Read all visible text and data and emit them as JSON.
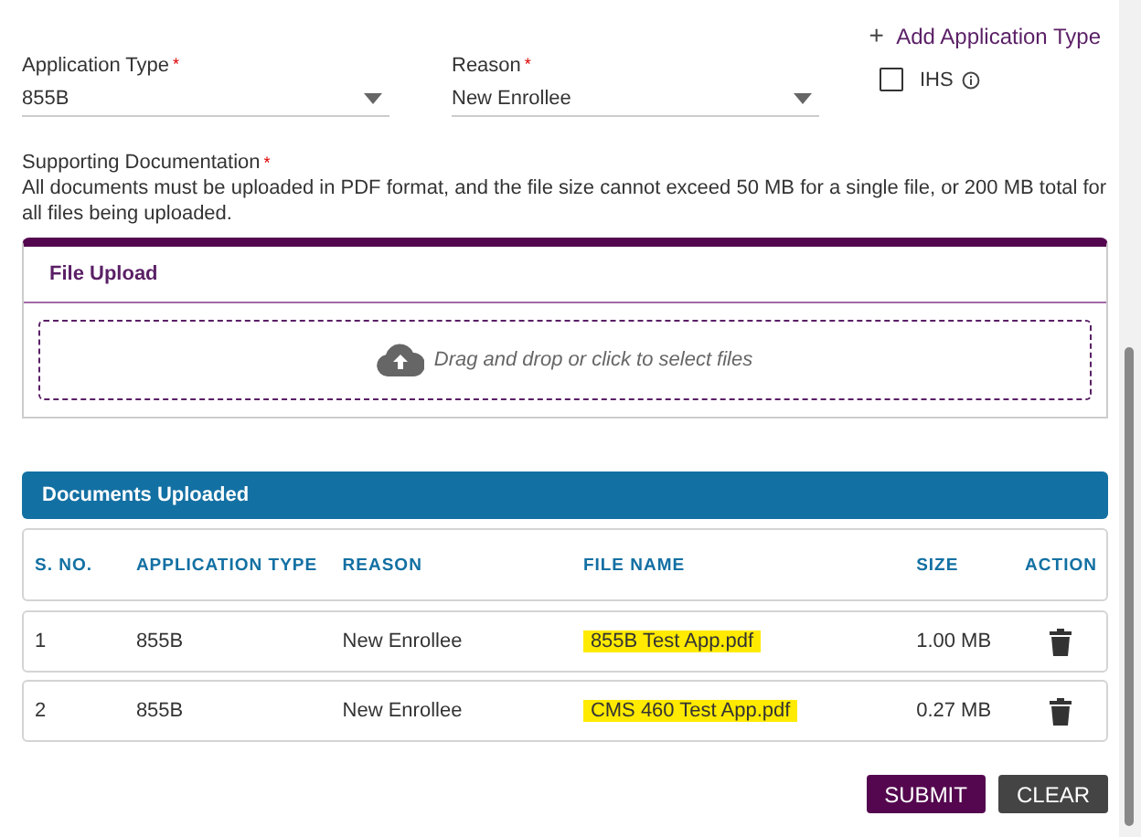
{
  "add_link": {
    "icon": "+",
    "label": "Add Application Type"
  },
  "fields": [
    {
      "label": "Application Type",
      "required_mark": "*",
      "value": "855B"
    },
    {
      "label": "Reason",
      "required_mark": "*",
      "value": "New Enrollee"
    }
  ],
  "ihs": {
    "label": "IHS",
    "checked": false
  },
  "supporting": {
    "label": "Supporting Documentation",
    "required_mark": "*",
    "note": "All documents must be uploaded in PDF format, and the file size cannot exceed 50 MB for a single file, or 200 MB total for all files being uploaded."
  },
  "upload": {
    "title": "File Upload",
    "dropzone": "Drag and drop or click to select files"
  },
  "documents": {
    "title": "Documents Uploaded",
    "columns": [
      "S. NO.",
      "APPLICATION TYPE",
      "REASON",
      "FILE NAME",
      "SIZE",
      "ACTION"
    ],
    "rows": [
      {
        "no": "1",
        "type": "855B",
        "reason": "New Enrollee",
        "file": "855B Test App.pdf",
        "highlighted": true,
        "size": "1.00 MB"
      },
      {
        "no": "2",
        "type": "855B",
        "reason": "New Enrollee",
        "file": "CMS 460 Test App.pdf",
        "highlighted": true,
        "size": "0.27 MB"
      }
    ]
  },
  "buttons": [
    {
      "label": "SUBMIT",
      "kind": "primary"
    },
    {
      "label": "CLEAR",
      "kind": "secondary"
    }
  ]
}
